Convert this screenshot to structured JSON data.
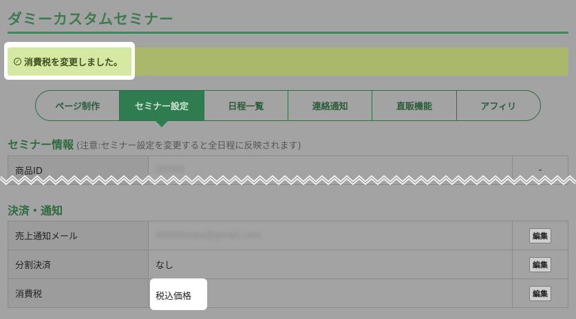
{
  "page": {
    "title": "ダミーカスタムセミナー"
  },
  "flash": {
    "message": "消費税を変更しました。"
  },
  "tabs": [
    {
      "label": "ページ制作",
      "active": false
    },
    {
      "label": "セミナー設定",
      "active": true
    },
    {
      "label": "日程一覧",
      "active": false
    },
    {
      "label": "連絡通知",
      "active": false
    },
    {
      "label": "直販機能",
      "active": false
    },
    {
      "label": "アフィリ",
      "active": false
    }
  ],
  "seminar_info": {
    "title": "セミナー情報",
    "note": "(注意:セミナー設定を変更すると全日程に反映されます)",
    "rows": [
      {
        "label": "商品ID",
        "value": "00000",
        "action": "-"
      }
    ]
  },
  "payment": {
    "title": "決済・通知",
    "rows": [
      {
        "label": "売上通知メール",
        "value": "dddddsupa@gmail.com",
        "action": "編集"
      },
      {
        "label": "分割決済",
        "value": "なし",
        "action": "編集"
      },
      {
        "label": "消費税",
        "value": "税込価格",
        "action": "編集"
      }
    ]
  },
  "colors": {
    "accent": "#2e7c4f",
    "flash": "#d6e9a3",
    "overlay": "#a3a3a3"
  }
}
